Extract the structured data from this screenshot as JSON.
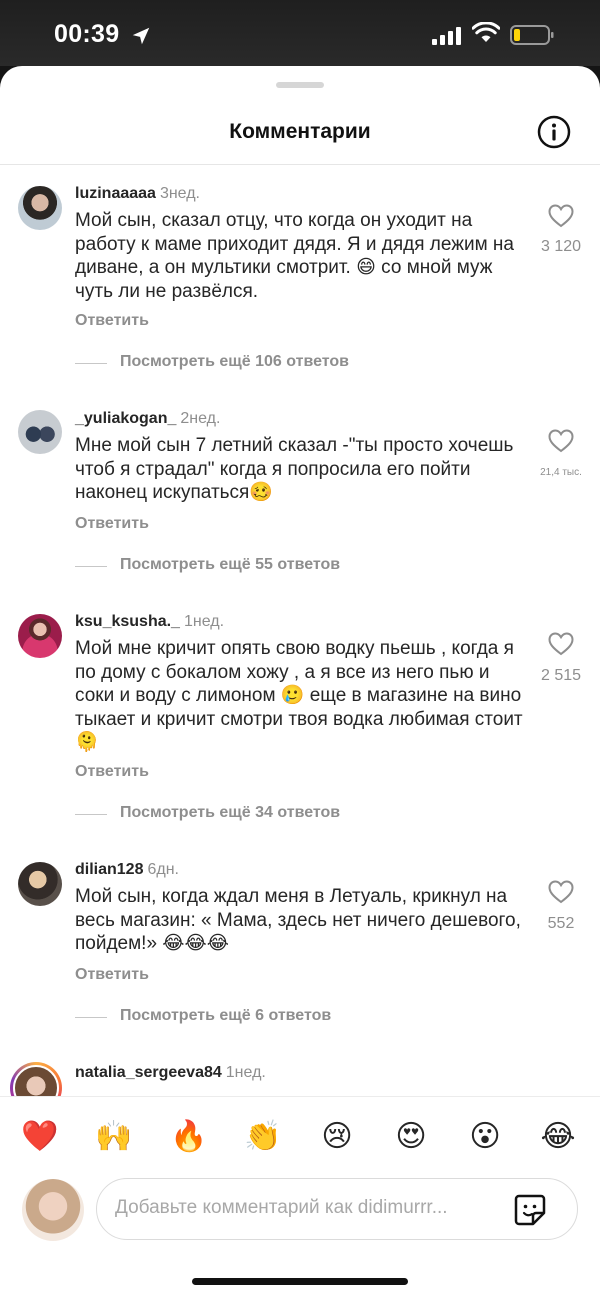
{
  "status_bar": {
    "time": "00:39"
  },
  "sheet": {
    "title": "Комментарии"
  },
  "reply_label": "Ответить",
  "comments": [
    {
      "username": "luzinaaaaa",
      "ago": "3нед.",
      "text": "Мой сын, сказал отцу, что когда он уходит на работу к маме приходит дядя. Я и дядя лежим на диване, а он мультики смотрит. 😄 со мной муж чуть ли не развёлся.",
      "likes": "3 120",
      "more": "Посмотреть ещё 106 ответов"
    },
    {
      "username": "_yuliakogan_",
      "ago": "2нед.",
      "text": "Мне мой сын 7 летний сказал -\"ты просто хочешь чтоб я страдал\" когда я попросила его пойти наконец искупаться🥴",
      "likes": "21,4 тыс.",
      "more": "Посмотреть ещё 55 ответов"
    },
    {
      "username": "ksu_ksusha._",
      "ago": "1нед.",
      "text": "Мой мне кричит опять свою водку пьешь , когда я по дому с бокалом хожу , а я все из него пью и соки и воду с лимоном 🥲 еще в магазине на вино тыкает и кричит смотри твоя водка любимая стоит 🫠",
      "likes": "2 515",
      "more": "Посмотреть ещё 34 ответов"
    },
    {
      "username": "dilian128",
      "ago": "6дн.",
      "text": "Мой сын, когда ждал меня в Летуаль, крикнул на весь магазин: « Мама, здесь нет ничего дешевого, пойдем!» 😂😂😂",
      "likes": "552",
      "more": "Посмотреть ещё 6 ответов"
    },
    {
      "username": "natalia_sergeeva84",
      "ago": "1нед."
    }
  ],
  "emoji_bar": [
    "❤️",
    "🙌",
    "🔥",
    "👏",
    "😢",
    "😍",
    "😮",
    "😂"
  ],
  "input": {
    "placeholder": "Добавьте комментарий как didimurrr..."
  }
}
